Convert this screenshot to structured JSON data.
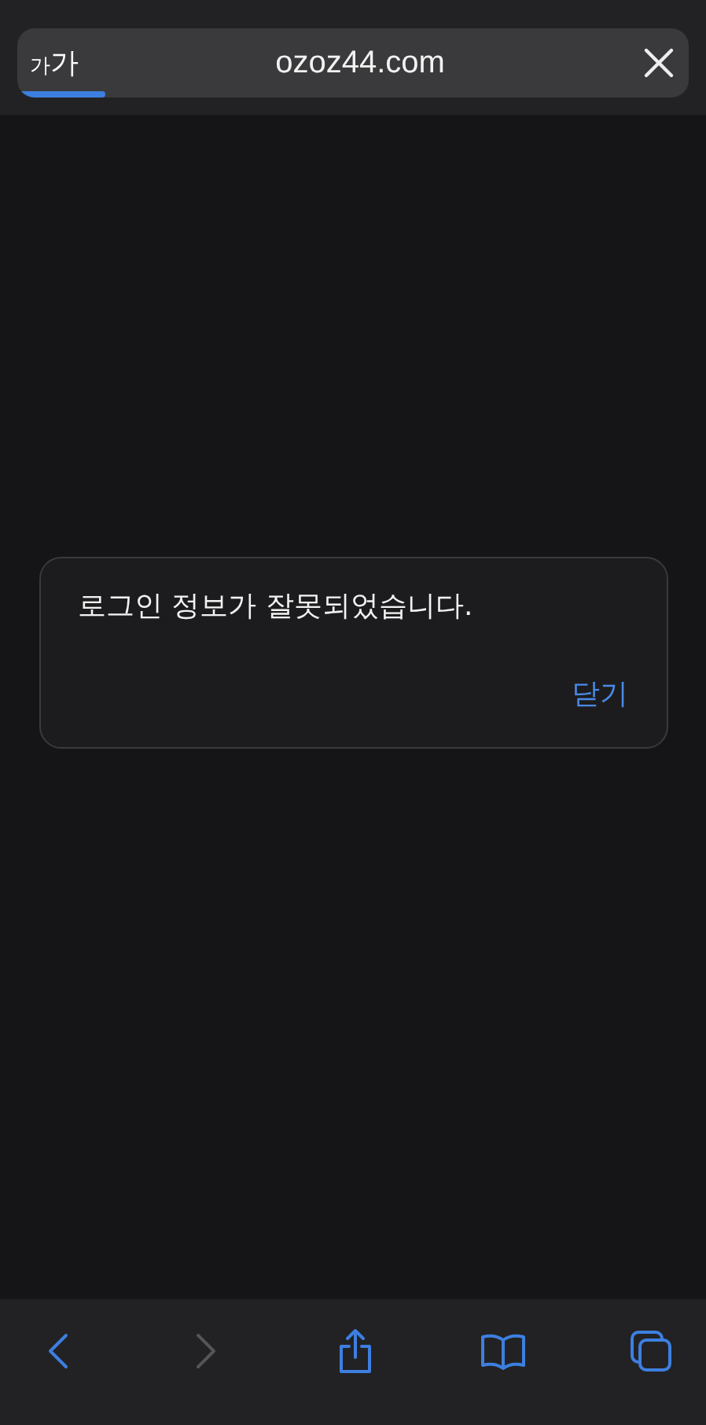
{
  "address_bar": {
    "reader_button": {
      "small": "가",
      "large": "가"
    },
    "url": "ozoz44.com",
    "loading": {
      "level": 0.13
    }
  },
  "dialog": {
    "message": "로그인 정보가 잘못되었습니다.",
    "button": "닫기"
  },
  "toolbar": [
    {
      "kind": "back",
      "disabled": false
    },
    {
      "kind": "forward",
      "disabled": true
    },
    {
      "kind": "share",
      "disabled": false
    },
    {
      "kind": "bookmarks",
      "disabled": false
    },
    {
      "kind": "tabs",
      "disabled": false
    }
  ]
}
